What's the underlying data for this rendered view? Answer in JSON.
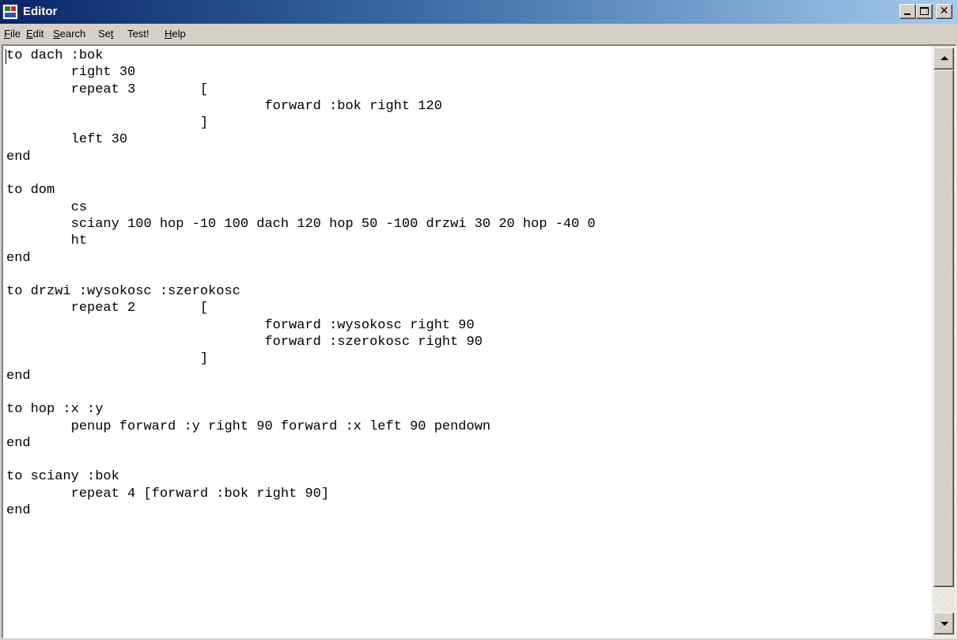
{
  "window": {
    "title": "Editor",
    "icon": "editor-app-icon",
    "controls": {
      "minimize": "minimize-icon",
      "maximize": "maximize-icon",
      "close": "✕"
    }
  },
  "menu": {
    "file": {
      "u": "F",
      "rest": "ile"
    },
    "edit": {
      "u": "E",
      "rest": "dit"
    },
    "search": {
      "u": "S",
      "rest": "earch"
    },
    "set": {
      "pre": "Se",
      "u": "t",
      "rest": ""
    },
    "test": {
      "label": "Test!"
    },
    "help": {
      "u": "H",
      "rest": "elp"
    }
  },
  "editor": {
    "code": "to dach :bok\n\tright 30\n\trepeat 3\t[\n\t\t\t\tforward :bok right 120\n\t\t\t]\n\tleft 30\nend\n\nto dom\n\tcs\n\tsciany 100 hop -10 100 dach 120 hop 50 -100 drzwi 30 20 hop -40 0\n\tht\nend\n\nto drzwi :wysokosc :szerokosc\n\trepeat 2\t[\n\t\t\t\tforward :wysokosc right 90\n\t\t\t\tforward :szerokosc right 90\n\t\t\t]\nend\n\nto hop :x :y\n\tpenup forward :y right 90 forward :x left 90 pendown\nend\n\nto sciany :bok\n\trepeat 4 [forward :bok right 90]\nend"
  },
  "scrollbar": {
    "up_icon": "arrow-up-icon",
    "down_icon": "arrow-down-icon"
  },
  "colors": {
    "title_bar_start": "#0a246a",
    "title_bar_end": "#a6caf0",
    "face": "#d4d0c8"
  }
}
